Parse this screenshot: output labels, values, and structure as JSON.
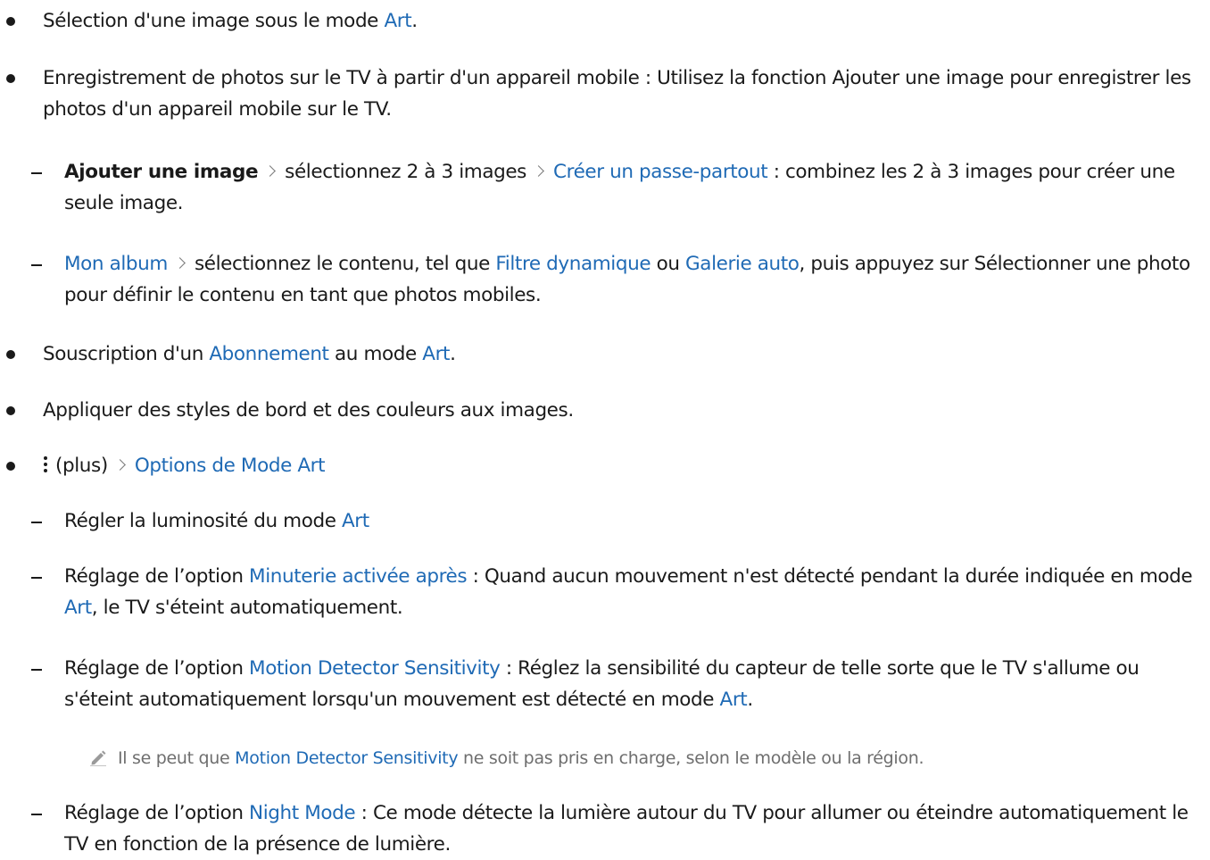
{
  "items": {
    "b1": {
      "pre": "Sélection d'une image sous le mode ",
      "link": "Art",
      "post": "."
    },
    "b2": {
      "text": "Enregistrement de photos sur le TV à partir d'un appareil mobile : Utilisez la fonction Ajouter une image pour enregistrer les photos d'un appareil mobile sur le TV."
    },
    "s1": {
      "bold": "Ajouter une image",
      "mid": "sélectionnez 2 à 3 images",
      "link": "Créer un passe-partout",
      "post": " : combinez les 2 à 3 images pour créer une seule image."
    },
    "s2": {
      "link1": "Mon album",
      "mid": "sélectionnez le contenu, tel que ",
      "link2": "Filtre dynamique",
      "mid2": " ou ",
      "link3": "Galerie auto",
      "post": ", puis appuyez sur Sélectionner une photo pour définir le contenu en tant que photos mobiles."
    },
    "b3": {
      "pre": "Souscription d'un ",
      "link1": "Abonnement",
      "mid": " au mode ",
      "link2": "Art",
      "post": "."
    },
    "b4": {
      "text": "Appliquer des styles de bord et des couleurs aux images."
    },
    "b5": {
      "pre": "(plus)",
      "link": "Options de Mode Art"
    },
    "s3": {
      "pre": "Régler la luminosité du mode ",
      "link": "Art"
    },
    "s4": {
      "pre": "Réglage de l’option ",
      "link1": "Minuterie activée après",
      "mid": " : Quand aucun mouvement n'est détecté pendant la durée indiquée en mode ",
      "link2": "Art",
      "post": ", le TV s'éteint automatiquement."
    },
    "s5": {
      "pre": "Réglage de l’option ",
      "link1": "Motion Detector Sensitivity",
      "mid": " : Réglez la sensibilité du capteur de telle sorte que le TV s'allume ou s'éteint automatiquement lorsqu'un mouvement est détecté en mode ",
      "link2": "Art",
      "post": "."
    },
    "note": {
      "pre": "Il se peut que ",
      "link": "Motion Detector Sensitivity",
      "post": " ne soit pas pris en charge, selon le modèle ou la région."
    },
    "s6": {
      "pre": "Réglage de l’option ",
      "link": "Night Mode",
      "post": " : Ce mode détecte la lumière autour du TV pour allumer ou éteindre automatiquement le TV en fonction de la présence de lumière."
    }
  },
  "icons": {
    "chevron": "chevron-right-icon",
    "more": "kebab-menu-icon",
    "note": "pencil-note-icon"
  },
  "colors": {
    "text": "#1a1a1a",
    "link": "#1f6ab5",
    "note": "#6e6e6e"
  }
}
